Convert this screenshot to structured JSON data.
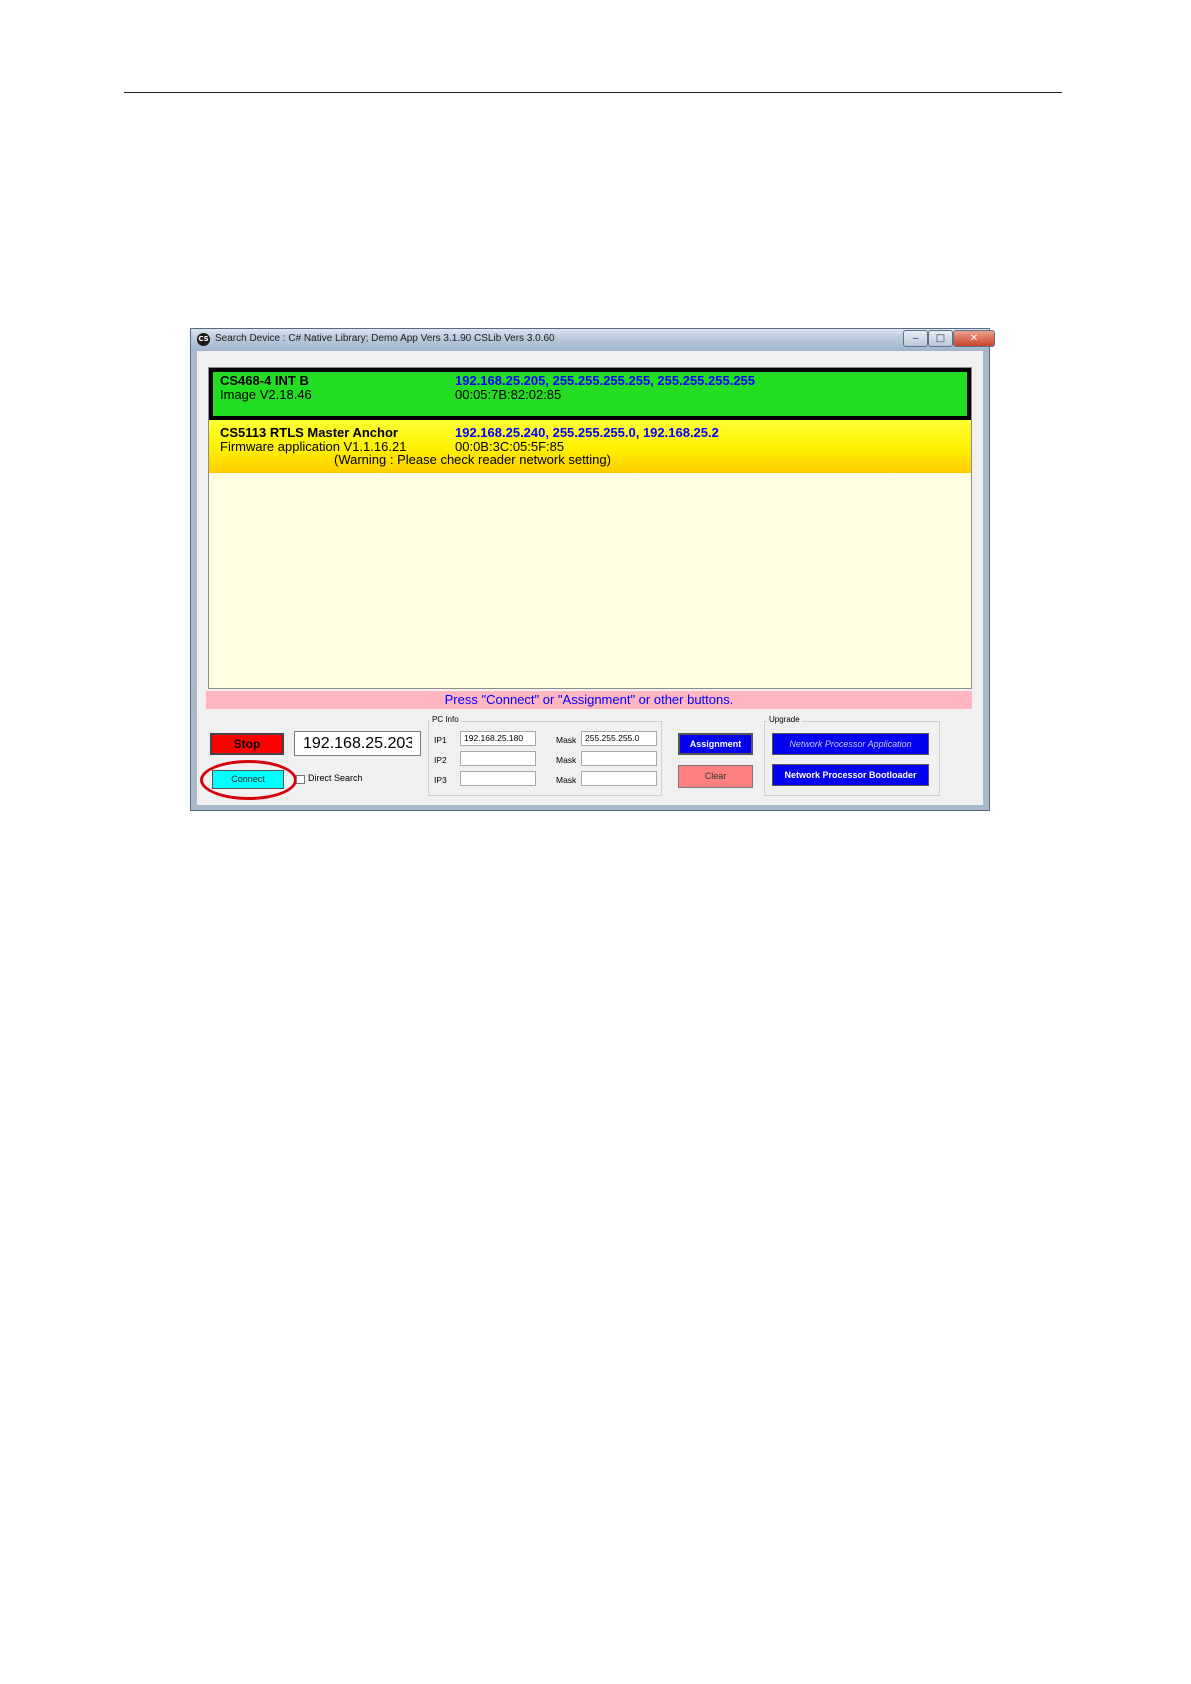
{
  "window": {
    "title": "Search Device : C# Native Library; Demo App Vers 3.1.90  CSLib Vers 3.0.60",
    "icon": "cs-app-icon",
    "controls": {
      "minimize": "‒",
      "maximize": "□",
      "close": "✕"
    }
  },
  "devices": [
    {
      "name": "CS468-4 INT B",
      "version": "Image V2.18.46",
      "network": "192.168.25.205, 255.255.255.255, 255.255.255.255",
      "mac": "00:05:7B:82:02:85",
      "status_color": "#22dd22",
      "selected": true
    },
    {
      "name": "CS5113 RTLS Master Anchor",
      "version": "Firmware application V1.1.16.21",
      "network": "192.168.25.240, 255.255.255.0, 192.168.25.2",
      "mac": "00:0B:3C:05:5F:85",
      "warning": "(Warning : Please check reader network setting)",
      "status_color": "#ffee00",
      "selected": false
    }
  ],
  "status_message": "Press \"Connect\" or \"Assignment\" or other buttons.",
  "controls": {
    "stop_label": "Stop",
    "ip_value": "192.168.25.203",
    "connect_label": "Connect",
    "direct_search_label": "Direct Search",
    "direct_search_checked": false
  },
  "pc_info": {
    "caption": "PC Info",
    "ip_labels": [
      "IP1",
      "IP2",
      "IP3"
    ],
    "mask_label": "Mask",
    "ip1": "192.168.25.180",
    "mask1": "255.255.255.0",
    "ip2": "",
    "mask2": "",
    "ip3": "",
    "mask3": ""
  },
  "actions": {
    "assignment_label": "Assignment",
    "clear_label": "Clear"
  },
  "upgrade": {
    "caption": "Upgrade",
    "np_application_label": "Network Processor Application",
    "np_bootloader_label": "Network Processor Bootloader"
  },
  "colors": {
    "stop": "#ff0000",
    "connect": "#00ffff",
    "assignment": "#0000ee",
    "clear": "#ff8080",
    "status_bar": "#ffb6c1",
    "highlight_circle": "#d6000b"
  }
}
